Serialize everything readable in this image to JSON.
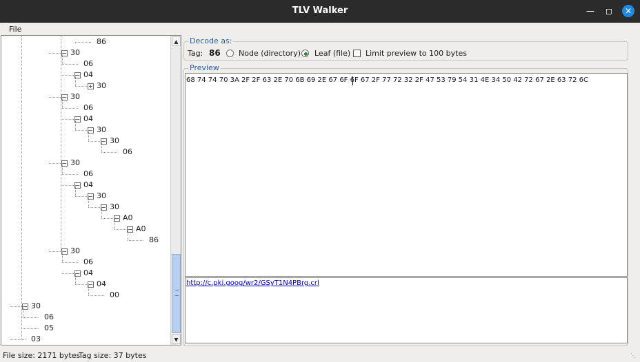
{
  "window": {
    "title": "TLV Walker"
  },
  "menu": {
    "file_label": "File"
  },
  "tree": {
    "nodes": [
      {
        "label": "86",
        "expander": ""
      },
      {
        "label": "30",
        "expander": "minus"
      },
      {
        "label": "06",
        "expander": ""
      },
      {
        "label": "04",
        "expander": "minus"
      },
      {
        "label": "30",
        "expander": "plus"
      },
      {
        "label": "30",
        "expander": "minus"
      },
      {
        "label": "06",
        "expander": ""
      },
      {
        "label": "04",
        "expander": "minus"
      },
      {
        "label": "30",
        "expander": "minus"
      },
      {
        "label": "30",
        "expander": "minus"
      },
      {
        "label": "06",
        "expander": ""
      },
      {
        "label": "30",
        "expander": "minus"
      },
      {
        "label": "06",
        "expander": ""
      },
      {
        "label": "04",
        "expander": "minus"
      },
      {
        "label": "30",
        "expander": "minus"
      },
      {
        "label": "30",
        "expander": "minus"
      },
      {
        "label": "A0",
        "expander": "minus"
      },
      {
        "label": "A0",
        "expander": "minus"
      },
      {
        "label": "86",
        "expander": ""
      },
      {
        "label": "30",
        "expander": "minus"
      },
      {
        "label": "06",
        "expander": ""
      },
      {
        "label": "04",
        "expander": "minus"
      },
      {
        "label": "04",
        "expander": "minus"
      },
      {
        "label": "00",
        "expander": ""
      },
      {
        "label": "30",
        "expander": "minus"
      },
      {
        "label": "06",
        "expander": ""
      },
      {
        "label": "05",
        "expander": ""
      },
      {
        "label": "03",
        "expander": ""
      }
    ]
  },
  "decode": {
    "group_title": "Decode as:",
    "tag_label": "Tag:",
    "tag_value": "86",
    "option_node": "Node (directory)",
    "option_leaf": "Leaf (file)",
    "selected": "leaf",
    "limit_label": "Limit preview to 100 bytes",
    "limit_checked": false
  },
  "preview": {
    "group_title": "Preview",
    "hex": "68 74 74 70 3A 2F 2F 63 2E 70 6B 69 2E 67 6F 6F 67 2F 77 72 32 2F 47 53 79 54 31 4E 34 50 42 72 67 2E 63 72 6C",
    "url": "http://c.pki.goog/wr2/GSyT1N4PBrg.crl"
  },
  "status": {
    "file_size": "File size: 2171 bytes",
    "tag_size": "Tag size: 37 bytes"
  },
  "colors": {
    "accent": "#1e88e5",
    "selection": "#2e7d32",
    "link": "#0000cc"
  }
}
